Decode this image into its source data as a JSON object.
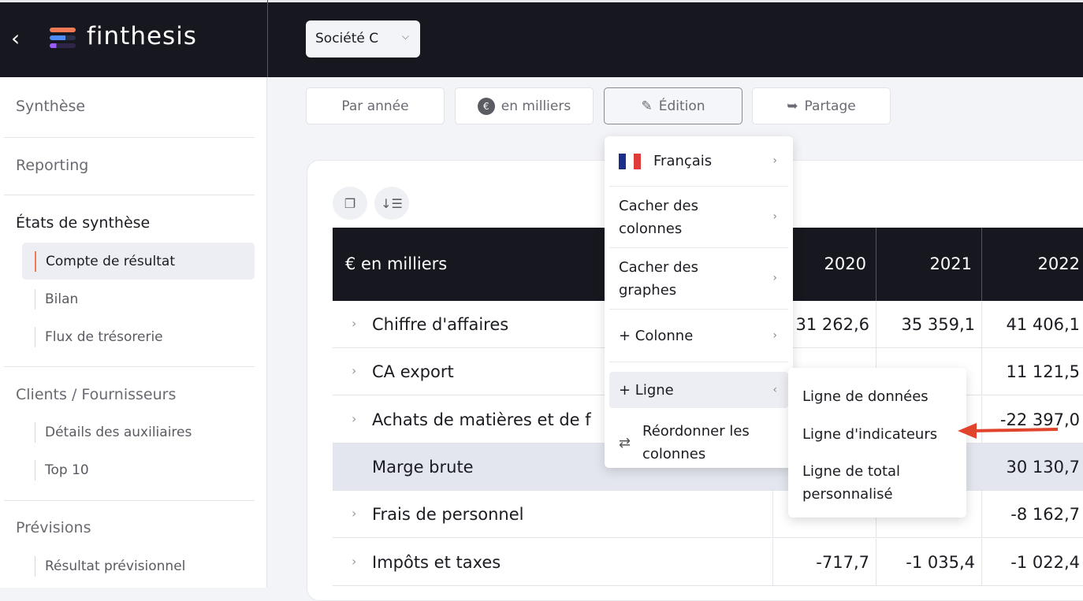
{
  "header": {
    "back_icon": "chevron-left-icon",
    "brand": "finthesis",
    "company": "Société C"
  },
  "sidebar": {
    "sections": [
      {
        "label": "Synthèse"
      },
      {
        "label": "Reporting"
      },
      {
        "label": "États de synthèse",
        "items": [
          "Compte de résultat",
          "Bilan",
          "Flux de trésorerie"
        ],
        "selected": "Compte de résultat"
      },
      {
        "label": "Clients / Fournisseurs",
        "items": [
          "Détails des auxiliaires",
          "Top 10"
        ]
      },
      {
        "label": "Prévisions",
        "items": [
          "Résultat prévisionnel"
        ]
      }
    ]
  },
  "toolbar": {
    "period": "Par année",
    "unit": "en milliers",
    "edit": "Édition",
    "share": "Partage"
  },
  "table": {
    "header_label": "€ en milliers",
    "years": [
      "2020",
      "2021",
      "2022"
    ],
    "rows": [
      {
        "label": "Chiffre d'affaires",
        "values": [
          "31 262,6",
          "35 359,1",
          "41 406,1"
        ],
        "expandable": true
      },
      {
        "label": "CA export",
        "values": [
          "",
          "",
          "11 121,5"
        ],
        "expandable": true
      },
      {
        "label": "Achats de matières et de f",
        "values": [
          "",
          "",
          "-22 397,0"
        ],
        "expandable": true
      },
      {
        "label": "Marge brute",
        "values": [
          "",
          "",
          "30 130,7"
        ],
        "expandable": false,
        "highlighted": true
      },
      {
        "label": "Frais de personnel",
        "values": [
          "",
          "",
          "-8 162,7"
        ],
        "expandable": true
      },
      {
        "label": "Impôts et taxes",
        "values": [
          "-717,7",
          "-1 035,4",
          "-1 022,4"
        ],
        "expandable": true
      }
    ]
  },
  "edit_menu": {
    "items": [
      "Français",
      "Cacher des colonnes",
      "Cacher des graphes",
      "+ Colonne",
      "+ Ligne",
      "Réordonner les colonnes"
    ],
    "active": "+ Ligne"
  },
  "submenu": {
    "items": [
      "Ligne de données",
      "Ligne d'indicateurs",
      "Ligne de total personnalisé"
    ]
  },
  "colors": {
    "accent": "#ef7a55",
    "dark": "#17171f",
    "annotation_arrow": "#e0442c"
  }
}
